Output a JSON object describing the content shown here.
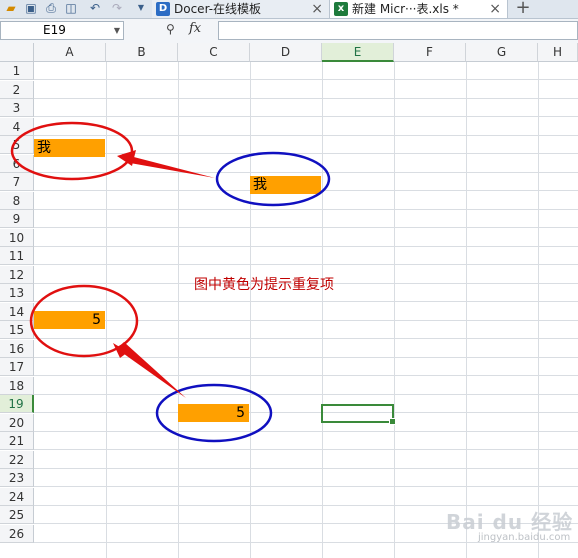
{
  "tabs": [
    {
      "label": "Docer-在线模板",
      "icon": "docer-icon"
    },
    {
      "label": "新建 Micr···表.xls *",
      "icon": "spreadsheet-file-icon"
    }
  ],
  "formula_bar": {
    "name_box": "E19",
    "fx_label": "fx",
    "formula": ""
  },
  "columns": [
    "A",
    "B",
    "C",
    "D",
    "E",
    "F",
    "G",
    "H"
  ],
  "selected_column": "E",
  "rows": [
    "1",
    "2",
    "3",
    "4",
    "5",
    "6",
    "7",
    "8",
    "9",
    "10",
    "11",
    "12",
    "13",
    "14",
    "15",
    "16",
    "17",
    "18",
    "19",
    "20",
    "21",
    "22",
    "23",
    "24",
    "25",
    "26"
  ],
  "selected_row": "19",
  "cells": {
    "a5": "我",
    "d7": "我",
    "a14": "5",
    "c19": "5"
  },
  "highlight_color": "#FFA000",
  "annotation": {
    "note": "图中黄色为提示重复项",
    "note_color": "#C00000",
    "red_ellipse_color": "#E01010",
    "blue_ellipse_color": "#1010C0"
  },
  "watermark": {
    "main": "Bai du 经验",
    "sub": "jingyan.baidu.com"
  }
}
